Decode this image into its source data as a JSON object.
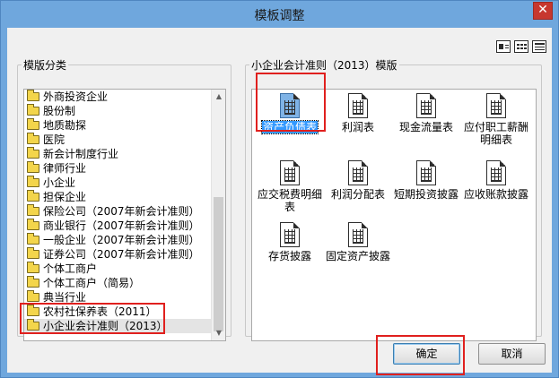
{
  "window": {
    "title": "模板调整",
    "close_label": "✕"
  },
  "left_group": {
    "legend": "模版分类",
    "items": [
      "外商投资企业",
      "股份制",
      "地质勘探",
      "医院",
      "新会计制度行业",
      "律师行业",
      "小企业",
      "担保企业",
      "保险公司（2007年新会计准则）",
      "商业银行（2007年新会计准则）",
      "一般企业（2007年新会计准则）",
      "证券公司（2007年新会计准则）",
      "个体工商户",
      "个体工商户（简易）",
      "典当行业",
      "农村社保养表（2011）",
      "小企业会计准则（2013）"
    ],
    "selected_index": 16
  },
  "right_group": {
    "legend": "小企业会计准则（2013）模版",
    "templates": [
      "资产负债表",
      "利润表",
      "现金流量表",
      "应付职工薪酬明细表",
      "应交税费明细表",
      "利润分配表",
      "短期投资披露",
      "应收账款披露",
      "存货披露",
      "固定资产披露"
    ],
    "selected_index": 0
  },
  "buttons": {
    "ok": "确定",
    "cancel": "取消"
  },
  "colors": {
    "highlight_box": "#e0201e",
    "selection": "#3399ff",
    "titlebar": "#6fa7dd"
  }
}
